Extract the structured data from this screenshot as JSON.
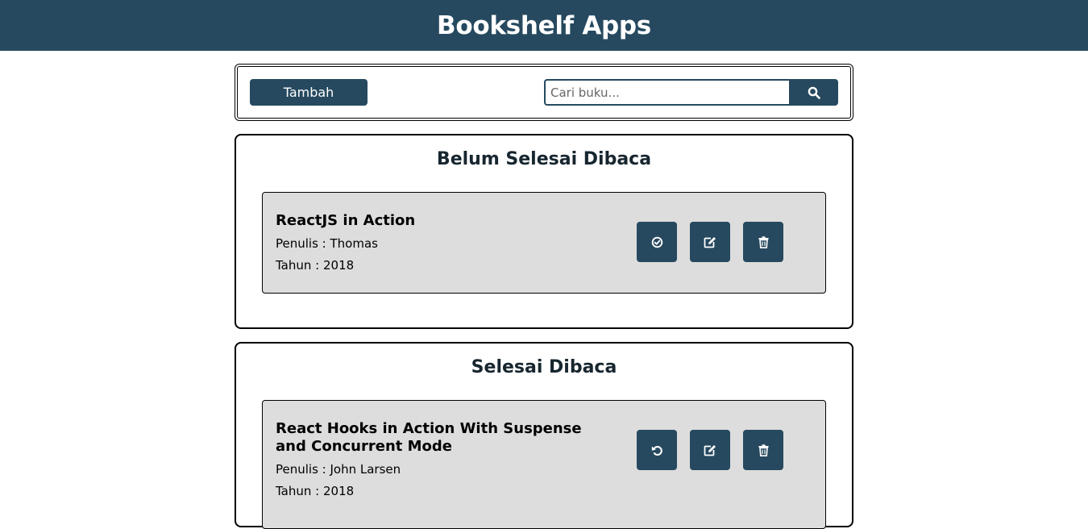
{
  "header": {
    "title": "Bookshelf Apps"
  },
  "toolbar": {
    "add_label": "Tambah",
    "search": {
      "placeholder": "Cari buku...",
      "value": ""
    },
    "search_button_icon": "search-icon"
  },
  "shelves": {
    "unfinished": {
      "title": "Belum Selesai Dibaca",
      "books": [
        {
          "title": "ReactJS in Action",
          "author": "Penulis : Thomas",
          "year": "Tahun : 2018",
          "actions": [
            "check-circle-icon",
            "edit-icon",
            "trash-icon"
          ]
        }
      ]
    },
    "finished": {
      "title": "Selesai Dibaca",
      "books": [
        {
          "title": "React Hooks in Action With Suspense and Concurrent Mode",
          "author": "Penulis : John Larsen",
          "year": "Tahun : 2018",
          "actions": [
            "undo-icon",
            "edit-icon",
            "trash-icon"
          ]
        }
      ]
    }
  },
  "colors": {
    "primary": "#26495f",
    "card_background": "#dddddd",
    "page_background": "#ffffff",
    "heading_text": "#17262f"
  }
}
